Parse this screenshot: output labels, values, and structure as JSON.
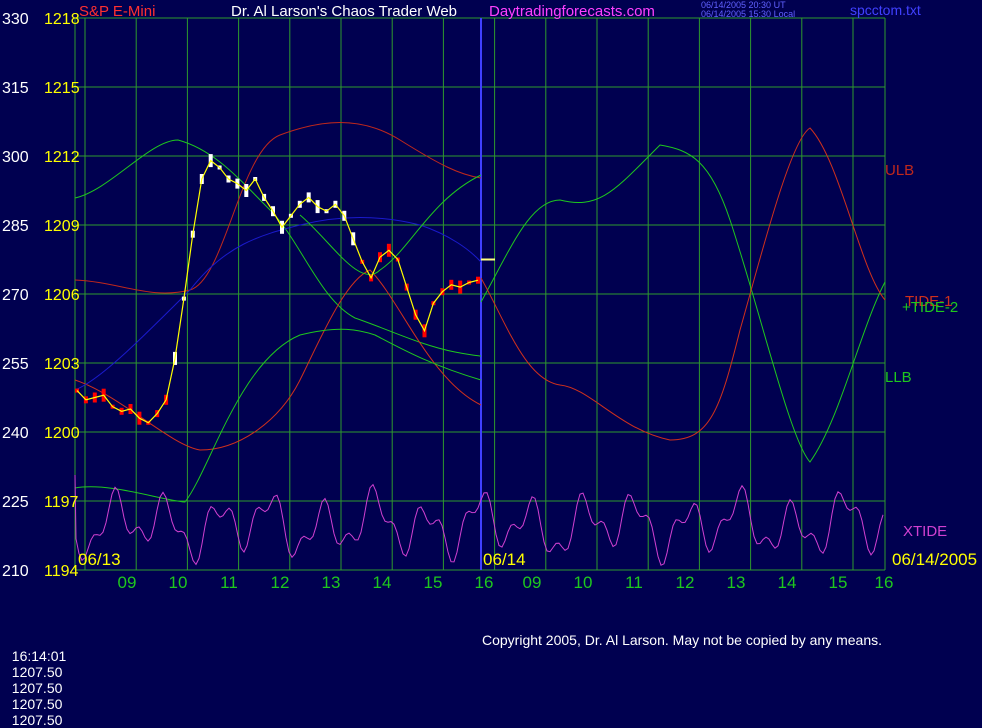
{
  "header": {
    "instrument": "S&P E-Mini",
    "title": "Dr. Al Larson's Chaos Trader Web",
    "site": "Daytradingforecasts.com",
    "time_utc": "06/14/2005 20:30 UT",
    "time_local": "06/14/2005 15:30 Local",
    "filename": "spcctom.txt"
  },
  "colors": {
    "background": "#000050",
    "grid": "#2e9a2e",
    "price": "#ffffff",
    "price_down": "#ff0000",
    "moving_avg": "#ffff00",
    "ulb": "#c0281c",
    "llb": "#1ec81e",
    "tide1": "#d0301c",
    "tide2": "#1ec81e",
    "xtide": "#d040d0",
    "blue_line": "#1a1acc"
  },
  "chart_data": {
    "type": "line",
    "y_left_ticks": [
      "330",
      "315",
      "300",
      "285",
      "270",
      "255",
      "240",
      "225",
      "210"
    ],
    "y_right_ticks": [
      "1218",
      "1215",
      "1212",
      "1209",
      "1206",
      "1203",
      "1200",
      "1197",
      "1194"
    ],
    "ylim": [
      1194,
      1218
    ],
    "x_ticks": [
      "09",
      "10",
      "11",
      "12",
      "13",
      "14",
      "15",
      "16",
      "09",
      "10",
      "11",
      "12",
      "13",
      "14",
      "15",
      "16"
    ],
    "date_labels": [
      "06/13",
      "06/14",
      "06/14/2005"
    ],
    "series": [
      {
        "name": "ULB"
      },
      {
        "name": "LLB"
      },
      {
        "name": "TIDE-1"
      },
      {
        "name": "+TIDE-2"
      },
      {
        "name": "XTIDE"
      }
    ],
    "price_series": [
      1201.8,
      1201.4,
      1201.5,
      1201.6,
      1201.1,
      1200.9,
      1201.0,
      1200.6,
      1200.4,
      1200.8,
      1201.4,
      1203.2,
      1205.8,
      1208.6,
      1211.0,
      1211.8,
      1211.5,
      1211.0,
      1210.8,
      1210.5,
      1211.0,
      1210.2,
      1209.6,
      1208.9,
      1209.4,
      1209.9,
      1210.2,
      1209.8,
      1209.6,
      1209.9,
      1209.4,
      1208.4,
      1207.4,
      1206.7,
      1207.6,
      1207.9,
      1207.5,
      1206.3,
      1205.1,
      1204.4,
      1205.6,
      1206.1,
      1206.4,
      1206.3,
      1206.5,
      1206.6
    ],
    "last_price_marker": 1207.5,
    "annotations": [
      "ULB",
      "LLB",
      "TIDE-1",
      "+TIDE-2",
      "XTIDE"
    ]
  },
  "status_line": {
    "time": "16:14:01",
    "values": [
      "1207.50",
      "1207.50",
      "1207.50",
      "1207.50"
    ]
  },
  "copyright": "Copyright 2005, Dr. Al Larson. May not be copied by any means."
}
